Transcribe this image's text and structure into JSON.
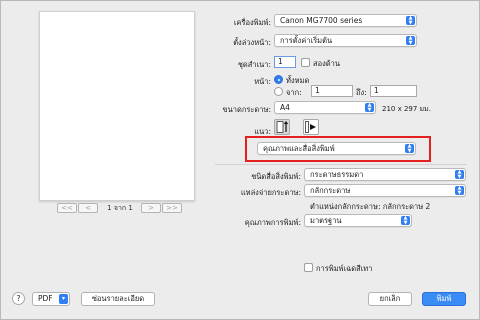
{
  "preview": {
    "pager": {
      "first": "<<",
      "prev": "<",
      "page_text": "1 จาก 1",
      "next": ">",
      "last": ">>"
    }
  },
  "settings": {
    "printer_label": "เครื่องพิมพ์:",
    "printer_value": "Canon MG7700 series",
    "presets_label": "ตั้งล่วงหน้า:",
    "presets_value": "การตั้งค่าเริ่มต้น",
    "copies_label": "ชุดสำเนา:",
    "copies_value": "1",
    "two_sided_label": "สองด้าน",
    "pages_label": "หน้า:",
    "pages_all": "ทั้งหมด",
    "pages_from": "จาก:",
    "from_value": "1",
    "pages_to": "ถึง:",
    "to_value": "1",
    "paper_size_label": "ขนาดกระดาษ:",
    "paper_size_value": "A4",
    "paper_size_dims": "210 x 297 มม.",
    "orientation_label": "แนว:",
    "section_value": "คุณภาพและสื่อสิ่งพิมพ์"
  },
  "quality": {
    "media_type_label": "ชนิดสื่อสิ่งพิมพ์:",
    "media_type_value": "กระดาษธรรมดา",
    "paper_source_label": "แหล่งจ่ายกระดาษ:",
    "paper_source_value": "กลักกระดาษ",
    "paper_position_note": "ตำแหน่งกลักกระดาษ: กลักกระดาษ 2",
    "print_quality_label": "คุณภาพการพิมพ์:",
    "print_quality_value": "มาตรฐาน",
    "grayscale_label": "การพิมพ์เฉดสีเทา"
  },
  "footer": {
    "help": "?",
    "pdf_label": "PDF",
    "hide_details": "ซ่อนรายละเอียด",
    "cancel": "ยกเลิก",
    "print": "พิมพ์"
  },
  "colors": {
    "accent": "#2f7ef3",
    "highlight": "#e5211d"
  }
}
